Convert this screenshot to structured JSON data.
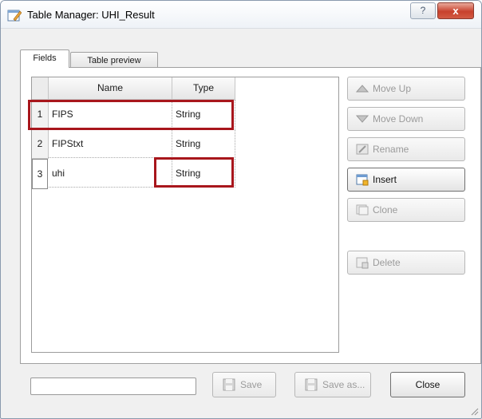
{
  "window": {
    "title": "Table Manager: UHI_Result",
    "help_label": "?",
    "close_label": "x"
  },
  "tabs": [
    {
      "label": "Fields",
      "active": true
    },
    {
      "label": "Table preview",
      "active": false
    }
  ],
  "table": {
    "columns": [
      "Name",
      "Type"
    ],
    "rows": [
      {
        "index": "1",
        "name": "FIPS",
        "type": "String"
      },
      {
        "index": "2",
        "name": "FIPStxt",
        "type": "String"
      },
      {
        "index": "3",
        "name": "uhi",
        "type": "String"
      }
    ]
  },
  "side_buttons": {
    "move_up": {
      "label": "Move Up",
      "icon": "triangle-up-icon",
      "enabled": false
    },
    "move_down": {
      "label": "Move Down",
      "icon": "triangle-down-icon",
      "enabled": false
    },
    "rename": {
      "label": "Rename",
      "icon": "rename-icon",
      "enabled": false
    },
    "insert": {
      "label": "Insert",
      "icon": "insert-field-icon",
      "enabled": true
    },
    "clone": {
      "label": "Clone",
      "icon": "clone-icon",
      "enabled": false
    },
    "delete": {
      "label": "Delete",
      "icon": "delete-icon",
      "enabled": false
    }
  },
  "bottom": {
    "input_value": "",
    "save_label": "Save",
    "save_as_label": "Save as...",
    "close_label": "Close"
  },
  "colors": {
    "highlight": "#a8161c",
    "close_button": "#c8412c"
  }
}
